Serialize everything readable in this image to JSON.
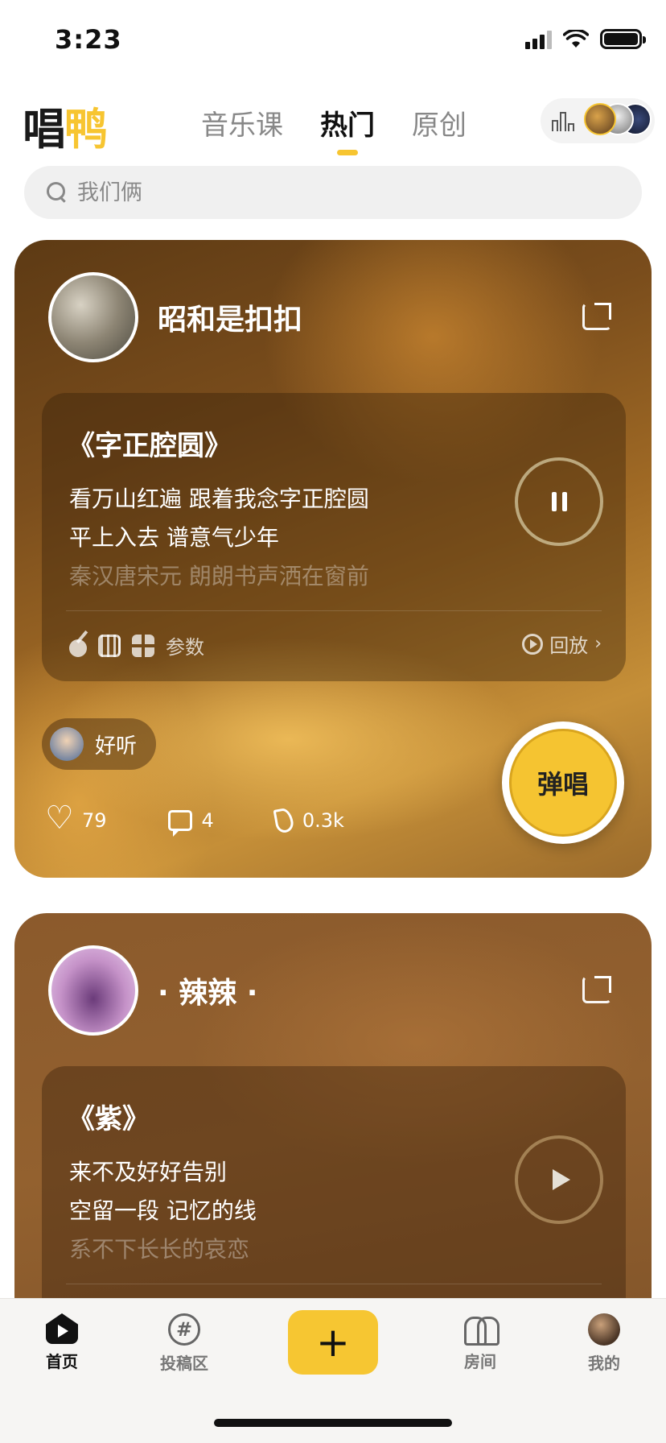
{
  "status_bar": {
    "time": "3:23"
  },
  "header": {
    "logo_left": "唱",
    "logo_right": "鸭",
    "tabs": [
      {
        "label": "音乐课",
        "active": false
      },
      {
        "label": "热门",
        "active": true
      },
      {
        "label": "原创",
        "active": false
      }
    ]
  },
  "search": {
    "placeholder": "我们俩"
  },
  "posts": [
    {
      "username": "昭和是扣扣",
      "song_title": "《字正腔圆》",
      "lyrics": [
        "看万山红遍 跟着我念字正腔圆",
        "平上入去 谱意气少年",
        "秦汉唐宋元 朗朗书声洒在窗前"
      ],
      "playing": true,
      "tools_label": "参数",
      "replay_label": "回放",
      "comment_chip": "好听",
      "stats": {
        "likes": "79",
        "comments": "4",
        "hot": "0.3k"
      },
      "sing_label": "弹唱"
    },
    {
      "username": "· 辣辣 ·",
      "song_title": "《紫》",
      "lyrics": [
        "来不及好好告别",
        "空留一段 记忆的线",
        "系不下长长的哀恋"
      ],
      "playing": false
    }
  ],
  "tabbar": {
    "items": [
      {
        "label": "首页",
        "icon": "home-icon",
        "active": true
      },
      {
        "label": "投稿区",
        "icon": "hash-icon",
        "active": false
      },
      {
        "label": "+",
        "icon": "plus-icon",
        "active": false
      },
      {
        "label": "房间",
        "icon": "room-icon",
        "active": false
      },
      {
        "label": "我的",
        "icon": "avatar",
        "active": false
      }
    ]
  },
  "colors": {
    "accent": "#f6c632",
    "card1_base": "#7a4d1c",
    "card2_base": "#8b5a2c"
  }
}
